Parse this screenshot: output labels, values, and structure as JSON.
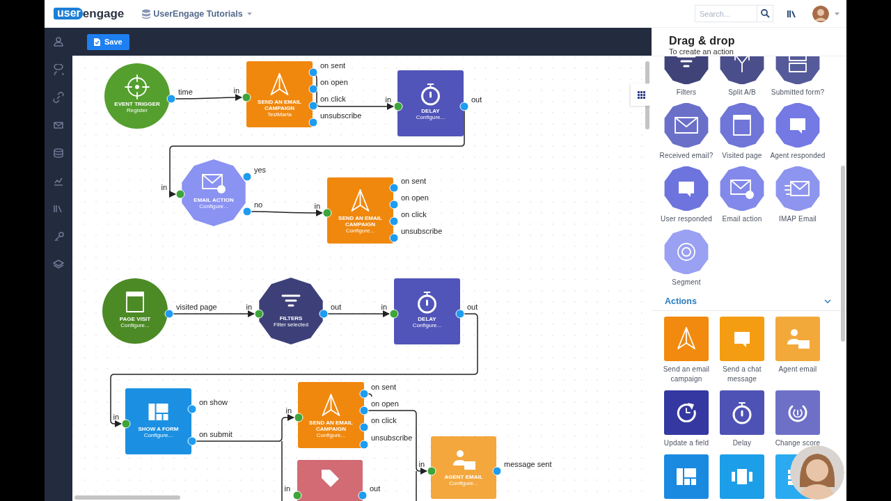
{
  "header": {
    "logo": {
      "badge": "user",
      "word": "engage"
    },
    "project": "UserEngage Tutorials",
    "search": {
      "placeholder": "Search..."
    }
  },
  "toolbar": {
    "save": "Save"
  },
  "canvas": {
    "nodes": [
      {
        "kind": "circle",
        "title": "EVENT TRIGGER",
        "subtitle": "Register",
        "color": "#559f2e",
        "outputs": [
          "time"
        ]
      },
      {
        "kind": "square",
        "title": "SEND AN EMAIL CAMPAIGN",
        "subtitle": "TestMarta",
        "color": "#f0880e",
        "inputs": [
          "in"
        ],
        "outputs": [
          "on sent",
          "on open",
          "on click",
          "unsubscribe"
        ]
      },
      {
        "kind": "square",
        "title": "DELAY",
        "subtitle": "Configure...",
        "color": "#5154b8",
        "inputs": [
          "in"
        ],
        "outputs": [
          "out"
        ]
      },
      {
        "kind": "decagon",
        "title": "EMAIL ACTION",
        "subtitle": "Configure...",
        "color": "#8a92f2",
        "inputs": [
          "in"
        ],
        "outputs": [
          "yes",
          "no"
        ]
      },
      {
        "kind": "square",
        "title": "SEND AN EMAIL CAMPAIGN",
        "subtitle": "Configure...",
        "color": "#f0880e",
        "inputs": [
          "in"
        ],
        "outputs": [
          "on sent",
          "on open",
          "on click",
          "unsubscribe"
        ]
      },
      {
        "kind": "circle",
        "title": "PAGE VISIT",
        "subtitle": "Configure...",
        "color": "#4c8a26",
        "outputs": [
          "visited page"
        ]
      },
      {
        "kind": "decagon",
        "title": "FILTERS",
        "subtitle": "Filter selected",
        "color": "#3d4078",
        "inputs": [
          "in"
        ],
        "outputs": [
          "out"
        ]
      },
      {
        "kind": "square",
        "title": "DELAY",
        "subtitle": "Configure...",
        "color": "#5154b8",
        "inputs": [
          "in"
        ],
        "outputs": [
          "out"
        ]
      },
      {
        "kind": "square",
        "title": "SHOW A FORM",
        "subtitle": "Configure...",
        "color": "#1b90e2",
        "inputs": [
          "in"
        ],
        "outputs": [
          "on show",
          "on submit"
        ]
      },
      {
        "kind": "square",
        "title": "SEND AN EMAIL CAMPAIGN",
        "subtitle": "Configure...",
        "color": "#f0880e",
        "inputs": [
          "in"
        ],
        "outputs": [
          "on sent",
          "on open",
          "on click",
          "unsubscribe"
        ]
      },
      {
        "kind": "square",
        "color": "#d26b73",
        "inputs": [
          "in"
        ],
        "outputs": [
          "out"
        ]
      },
      {
        "kind": "square",
        "title": "AGENT EMAIL",
        "subtitle": "Configure...",
        "color": "#f3a73c",
        "inputs": [
          "in"
        ],
        "outputs": [
          "message sent"
        ]
      }
    ]
  },
  "panel": {
    "title": "Drag & drop",
    "subtitle": "To create an action",
    "conditions": [
      {
        "label": "Filters",
        "color": "#3f4378"
      },
      {
        "label": "Split A/B",
        "color": "#4a4e8a"
      },
      {
        "label": "Submitted form?",
        "color": "#555a9a"
      },
      {
        "label": "Received email?",
        "color": "#6a70c8"
      },
      {
        "label": "Visited page",
        "color": "#6f76d8"
      },
      {
        "label": "Agent responded",
        "color": "#7479e4"
      },
      {
        "label": "User responded",
        "color": "#6d74dd"
      },
      {
        "label": "Email action",
        "color": "#8289ea"
      },
      {
        "label": "IMAP Email",
        "color": "#8e95ee"
      },
      {
        "label": "Segment",
        "color": "#9aa0f2"
      }
    ],
    "actions_section": {
      "title": "Actions",
      "expanded": true
    },
    "actions": [
      {
        "label": "Send an email campaign",
        "color": "#f18a0e"
      },
      {
        "label": "Send a chat message",
        "color": "#f59d12"
      },
      {
        "label": "Agent email",
        "color": "#f3a93a"
      },
      {
        "label": "Update a field",
        "color": "#3438a0"
      },
      {
        "label": "Delay",
        "color": "#4e52b4"
      },
      {
        "label": "Change score",
        "color": "#6e70c8"
      },
      {
        "color": "#1a8ae0"
      },
      {
        "color": "#1d9ee8"
      },
      {
        "color": "#2aaaf0"
      }
    ]
  }
}
